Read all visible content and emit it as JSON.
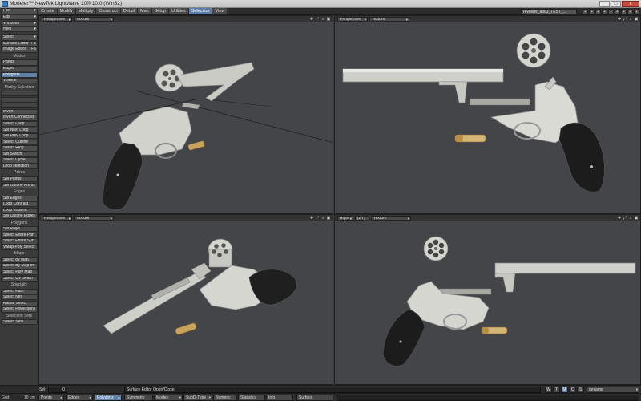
{
  "window": {
    "title": "Modeler™ NewTek LightWave 10® 10.0 (Win32)",
    "minimize": "_",
    "maximize": "□",
    "close": "x"
  },
  "menubar": {
    "tabs": [
      "Create",
      "Modify",
      "Multiply",
      "Construct",
      "Detail",
      "Map",
      "Setup",
      "Utilities",
      "Selection",
      "View"
    ],
    "active_tab": "Selection",
    "object_name": "revolver_alto3_TEST_..."
  },
  "sidebar": {
    "top_menus": [
      "File",
      "Edit",
      "Windows",
      "Help"
    ],
    "top_buttons": [
      "Select",
      "Surface Editor",
      "Image Editor"
    ],
    "top_button_shortcuts": [
      "",
      "F5",
      "F6"
    ],
    "sections": [
      {
        "header": "Modes",
        "items": [
          "Points",
          "Edges",
          "Polygons",
          "Volume"
        ]
      },
      {
        "header": "Modify Selection",
        "items": [
          "",
          "",
          "",
          "Invert",
          "Invert Connected",
          "Select Loop",
          "Sel Next Loop",
          "Sel Prev Loop",
          "Select Outline",
          "Select Ring",
          "Sel Switch",
          "Select Cycle",
          "Drop selection"
        ]
      },
      {
        "header": "Points",
        "items": [
          "Sel Points",
          "Sel Outline Points"
        ]
      },
      {
        "header": "Edges",
        "items": [
          "Sel Edges",
          "Loop Contract",
          "Loop Expand",
          "Sel Outline Edges"
        ]
      },
      {
        "header": "Polygons",
        "items": [
          "Sel Polys",
          "Select Entire Part",
          "Select Entire Surf",
          "VMap Poly Select"
        ]
      },
      {
        "header": "Maps",
        "items": [
          "Select by Map",
          "Select By Map Inf",
          "Select Poly Map",
          "Select UV Seam"
        ]
      },
      {
        "header": "Specialty",
        "items": [
          "Select Path",
          "Select Nth",
          "Radial Select",
          "Select Powergons"
        ]
      },
      {
        "header": "Selection Sets",
        "items": [
          "Select Sets"
        ]
      }
    ],
    "active_mode": "Polygons"
  },
  "viewports": [
    {
      "view": "Perspective",
      "render": "Texture"
    },
    {
      "view": "Perspective",
      "render": "Texture"
    },
    {
      "view": "Perspective",
      "render": "Texture"
    },
    {
      "view": "Right",
      "axes": "(ZY)",
      "render": "Texture"
    }
  ],
  "viewport_icons": [
    "✥",
    "⤢",
    "⌕",
    "▣"
  ],
  "status": {
    "sel_label": "Sel:",
    "sel_value": "0",
    "message": "Surface Editor Open/Close",
    "wtmcs": [
      "W",
      "T",
      "M",
      "C",
      "S"
    ],
    "wtmcs_active": "M",
    "surface_value": "dexame",
    "grid_label": "Grid:",
    "grid_value": "10 cm",
    "buttons": [
      "Points",
      "Edges",
      "Polygons",
      "Symmetry",
      "Modes",
      "SubD-Type",
      "Numeric",
      "Statistics",
      "Info",
      "Surface"
    ],
    "active_button": "Polygons"
  },
  "colors": {
    "accent": "#5d7fa8",
    "viewport_bg": "#444548",
    "metal": "#c9c9c4",
    "grip": "#1e1e1e",
    "brass": "#c9a35c"
  }
}
